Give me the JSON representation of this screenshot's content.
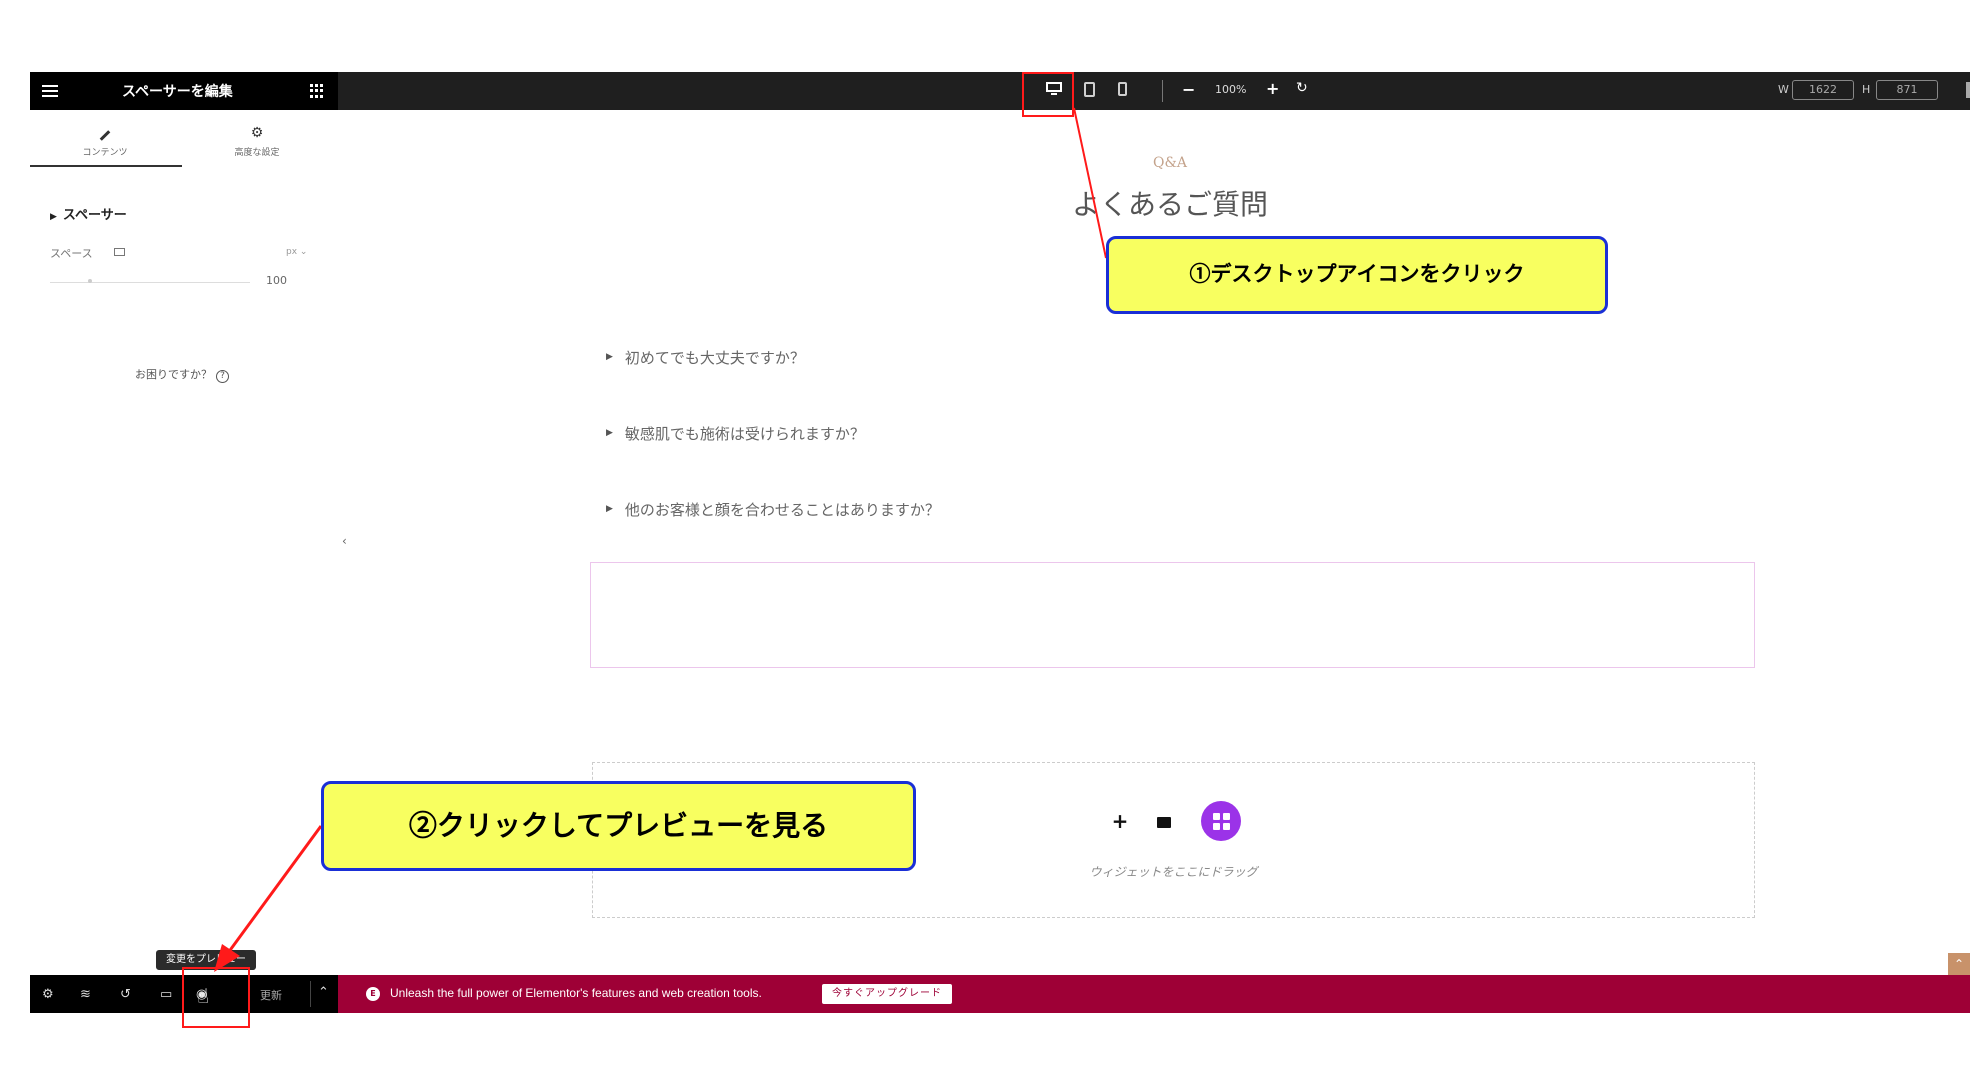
{
  "header": {
    "panel_title": "スペーサーを編集",
    "zoom": "100%",
    "width_label": "W",
    "width_value": "1622",
    "height_label": "H",
    "height_value": "871"
  },
  "panel": {
    "tabs": [
      {
        "label": "コンテンツ",
        "active": true
      },
      {
        "label": "高度な設定",
        "active": false
      }
    ],
    "section_title": "スペーサー",
    "space_label": "スペース",
    "unit": "px",
    "space_value": "100",
    "help_text": "お困りですか？"
  },
  "canvas": {
    "subtitle": "Q&A",
    "title": "よくあるご質問",
    "faq_items": [
      "初めてでも大丈夫ですか？",
      "敏感肌でも施術は受けられますか？",
      "他のお客様と顔を合わせることはありますか？"
    ],
    "drop_zone_text": "ウィジェットをここにドラッグ"
  },
  "bottom_bar": {
    "update_label": "更新",
    "tooltip": "変更をプレビュー",
    "promo_text": "Unleash the full power of Elementor's features and web creation tools.",
    "promo_button": "今すぐアップグレード"
  },
  "annotations": {
    "callout_1": "①デスクトップアイコンをクリック",
    "callout_2": "②クリックしてプレビューを見る",
    "highlight_color": "#ff1a1a",
    "callout_fill": "#f8ff60",
    "callout_border": "#1a2fd6"
  },
  "colors": {
    "topbar": "#1f1f1f",
    "promo_bar": "#9e0036",
    "widget_button": "#9b33e8"
  }
}
